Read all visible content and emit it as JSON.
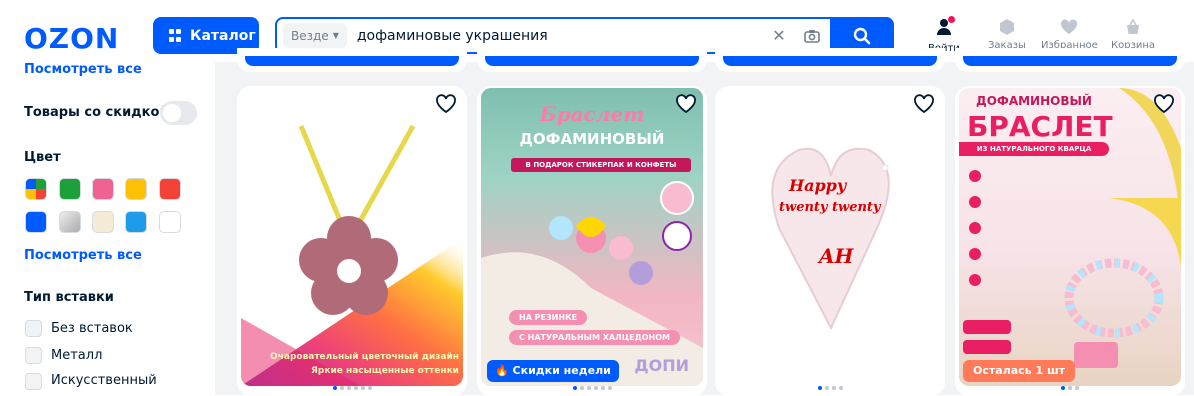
{
  "header": {
    "logo": "OZON",
    "catalog_label": "Каталог",
    "search": {
      "scope": "Везде",
      "query": "дофаминовые украшения"
    },
    "nav": {
      "login": "Войти",
      "orders": "Заказы",
      "favorites": "Избранное",
      "cart": "Корзина"
    }
  },
  "sidebar": {
    "see_all_top": "Посмотреть все",
    "discount_label": "Товары со скидкой",
    "color_title": "Цвет",
    "colors": [
      "multicolor",
      "#1da03a",
      "#f06292",
      "#ffc107",
      "#f44336",
      "#005bff",
      "#bdbdbd",
      "#f5ecd7",
      "#1e9be9",
      "#ffffff"
    ],
    "see_all_colors": "Посмотреть все",
    "insert_title": "Тип вставки",
    "insert_options": [
      "Без вставок",
      "Металл",
      "Искусственный"
    ]
  },
  "products": [
    {
      "overlay_1": "Очаровательный цветочный дизайн",
      "overlay_2": "Яркие насыщенные оттенки"
    },
    {
      "title_1": "Браслет",
      "title_2": "ДОФАМИНОВЫЙ",
      "subtitle": "В ПОДАРОК СТИКЕРПАК И КОНФЕТЫ",
      "tag_1": "НА РЕЗИНКЕ",
      "tag_2": "С НАТУРАЛЬНЫМ ХАЛЦЕДОНОМ",
      "badge": "Скидки недели",
      "brand": "ДОПИ"
    },
    {
      "engraving_1": "Happy",
      "engraving_2": "twenty twenty",
      "engraving_3": "AH"
    },
    {
      "title_1": "ДОФАМИНОВЫЙ",
      "title_2": "БРАСЛЕТ",
      "subtitle": "ИЗ НАТУРАЛЬНОГО КВАРЦА",
      "badge": "Осталась 1 шт"
    }
  ]
}
